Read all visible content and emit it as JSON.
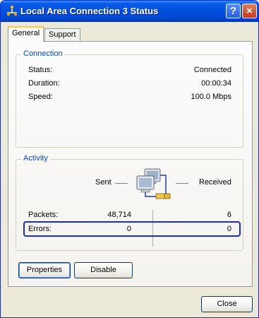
{
  "window": {
    "title": "Local Area Connection 3 Status",
    "icon": "network-connection-icon",
    "help_label": "?",
    "close_label": "×"
  },
  "tabs": [
    {
      "label": "General",
      "active": true
    },
    {
      "label": "Support",
      "active": false
    }
  ],
  "connection": {
    "group_label": "Connection",
    "rows": [
      {
        "label": "Status:",
        "value": "Connected"
      },
      {
        "label": "Duration:",
        "value": "00:00:34"
      },
      {
        "label": "Speed:",
        "value": "100.0 Mbps"
      }
    ]
  },
  "activity": {
    "group_label": "Activity",
    "sent_label": "Sent",
    "received_label": "Received",
    "icon": "network-computers-icon",
    "packets": {
      "label": "Packets:",
      "sent": "48,714",
      "received": "6"
    },
    "errors": {
      "label": "Errors:",
      "sent": "0",
      "received": "0"
    }
  },
  "buttons": {
    "properties": "Properties",
    "disable": "Disable",
    "close": "Close"
  },
  "colors": {
    "titlebar": "#0052e0",
    "group_label": "#0046d5",
    "highlight": "#1d2bd6"
  }
}
